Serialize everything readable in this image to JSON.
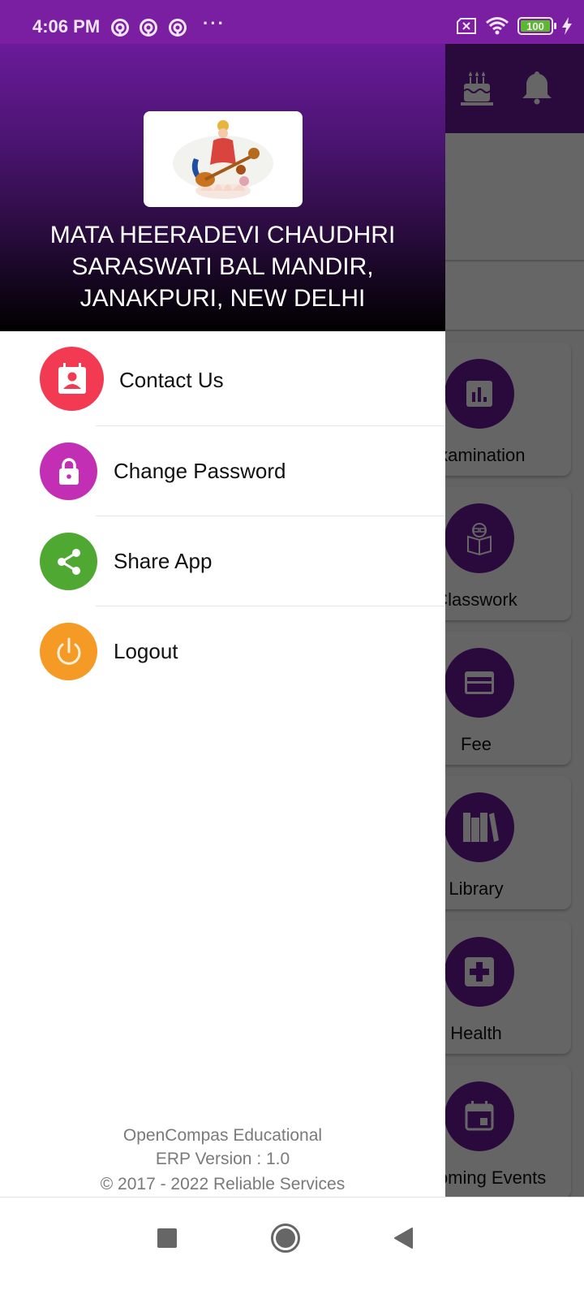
{
  "status_bar": {
    "time": "4:06 PM",
    "notification_icons": [
      "app-notification-icon",
      "app-notification-icon",
      "app-notification-icon"
    ],
    "more_indicator": "···",
    "battery_level": "100",
    "icons": [
      "no-sim-icon",
      "wifi-icon",
      "battery-icon",
      "charging-icon"
    ]
  },
  "background_app": {
    "toolbar_icons": [
      "birthday-cake-icon",
      "notification-bell-icon"
    ],
    "cards": [
      {
        "label": "Examination",
        "visible_label": "amination",
        "icon": "chart-icon"
      },
      {
        "label": "Classwork",
        "visible_label": "lasswork",
        "icon": "reading-icon"
      },
      {
        "label": "Fee",
        "visible_label": "Fee",
        "icon": "credit-card-icon"
      },
      {
        "label": "Library",
        "visible_label": "Library",
        "icon": "books-icon"
      },
      {
        "label": "Health",
        "visible_label": "Health",
        "icon": "medical-icon"
      },
      {
        "label": "Upcoming Events",
        "visible_label": "oming Events",
        "icon": "calendar-icon"
      }
    ]
  },
  "drawer": {
    "logo_alt": "Saraswati logo",
    "school_name_lines": [
      "MATA HEERADEVI CHAUDHRI",
      "SARASWATI BAL MANDIR,",
      "JANAKPURI, NEW DELHI"
    ],
    "menu": [
      {
        "label": "Contact Us",
        "icon": "contact-icon",
        "color": "#f23b53"
      },
      {
        "label": "Change Password",
        "icon": "lock-icon",
        "color": "#c22fb4"
      },
      {
        "label": "Share App",
        "icon": "share-icon",
        "color": "#4fa831"
      },
      {
        "label": "Logout",
        "icon": "power-icon",
        "color": "#f59a24"
      }
    ],
    "footer": {
      "line1": "OpenCompas Educational",
      "line2": "ERP Version : 1.0",
      "line3": "© 2017 - 2022 Reliable Services"
    }
  },
  "colors": {
    "status_bar": "#7b1fa2",
    "primary": "#6a1b9a"
  },
  "nav_bar": {
    "buttons": [
      "recents-button",
      "home-button",
      "back-button"
    ]
  }
}
